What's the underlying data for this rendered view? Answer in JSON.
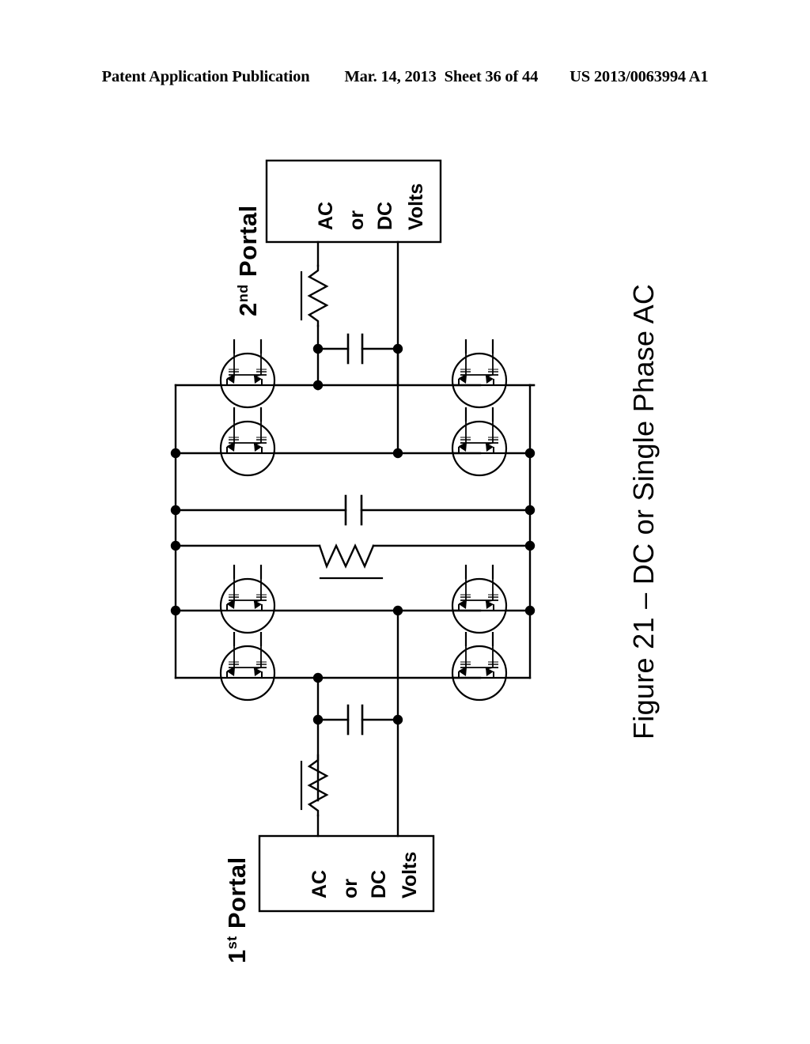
{
  "header": {
    "publication": "Patent Application Publication",
    "date": "Mar. 14, 2013",
    "sheet": "Sheet 36 of 44",
    "number": "US 2013/0063994 A1"
  },
  "figure": {
    "caption": "Figure 21 – DC or Single Phase AC",
    "portal_top": {
      "ordinal": "2",
      "suffix": "nd",
      "word": "Portal"
    },
    "portal_bottom": {
      "ordinal": "1",
      "suffix": "st",
      "word": "Portal"
    },
    "source_box_top": {
      "lines": [
        "AC",
        "or",
        "DC",
        "Volts"
      ]
    },
    "source_box_bottom": {
      "lines": [
        "AC",
        "or",
        "DC",
        "Volts"
      ]
    },
    "components": {
      "switch_count": 8,
      "switch_name": "bidirectional-switch",
      "inductor_count": 3,
      "capacitor_count": 3,
      "junction_dot_count": 18
    },
    "colors": {
      "ink": "#000000",
      "paper": "#ffffff"
    }
  }
}
